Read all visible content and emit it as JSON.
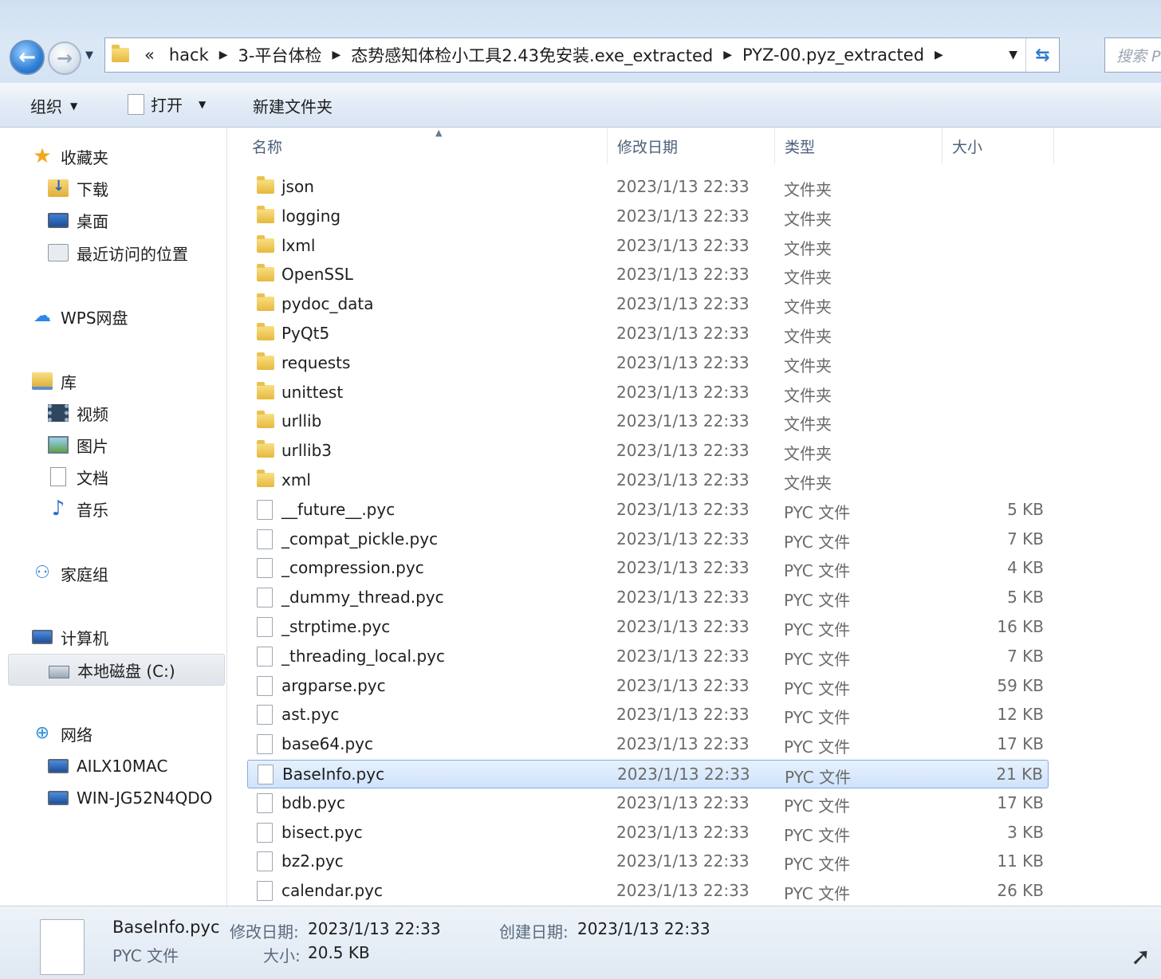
{
  "address": {
    "overflow_label": "«",
    "crumbs": [
      "hack",
      "3-平台体检",
      "态势感知体检小工具2.43免安装.exe_extracted",
      "PYZ-00.pyz_extracted"
    ],
    "search_placeholder": "搜索 P"
  },
  "toolbar": {
    "organize": "组织",
    "open": "打开",
    "new_folder": "新建文件夹"
  },
  "nav": {
    "favorites": "收藏夹",
    "downloads": "下载",
    "desktop": "桌面",
    "recent": "最近访问的位置",
    "wps": "WPS网盘",
    "libraries": "库",
    "videos": "视频",
    "pictures": "图片",
    "documents": "文档",
    "music": "音乐",
    "homegroup": "家庭组",
    "computer": "计算机",
    "local_disk": "本地磁盘 (C:)",
    "network": "网络",
    "net_pc1": "AILX10MAC",
    "net_pc2": "WIN-JG52N4QDO"
  },
  "columns": {
    "name": "名称",
    "modified": "修改日期",
    "type": "类型",
    "size": "大小"
  },
  "files": [
    {
      "name": "json",
      "date": "2023/1/13 22:33",
      "type": "文件夹",
      "size": "",
      "kind": "folder"
    },
    {
      "name": "logging",
      "date": "2023/1/13 22:33",
      "type": "文件夹",
      "size": "",
      "kind": "folder"
    },
    {
      "name": "lxml",
      "date": "2023/1/13 22:33",
      "type": "文件夹",
      "size": "",
      "kind": "folder"
    },
    {
      "name": "OpenSSL",
      "date": "2023/1/13 22:33",
      "type": "文件夹",
      "size": "",
      "kind": "folder"
    },
    {
      "name": "pydoc_data",
      "date": "2023/1/13 22:33",
      "type": "文件夹",
      "size": "",
      "kind": "folder"
    },
    {
      "name": "PyQt5",
      "date": "2023/1/13 22:33",
      "type": "文件夹",
      "size": "",
      "kind": "folder"
    },
    {
      "name": "requests",
      "date": "2023/1/13 22:33",
      "type": "文件夹",
      "size": "",
      "kind": "folder"
    },
    {
      "name": "unittest",
      "date": "2023/1/13 22:33",
      "type": "文件夹",
      "size": "",
      "kind": "folder"
    },
    {
      "name": "urllib",
      "date": "2023/1/13 22:33",
      "type": "文件夹",
      "size": "",
      "kind": "folder"
    },
    {
      "name": "urllib3",
      "date": "2023/1/13 22:33",
      "type": "文件夹",
      "size": "",
      "kind": "folder"
    },
    {
      "name": "xml",
      "date": "2023/1/13 22:33",
      "type": "文件夹",
      "size": "",
      "kind": "folder"
    },
    {
      "name": "__future__.pyc",
      "date": "2023/1/13 22:33",
      "type": "PYC 文件",
      "size": "5 KB",
      "kind": "file"
    },
    {
      "name": "_compat_pickle.pyc",
      "date": "2023/1/13 22:33",
      "type": "PYC 文件",
      "size": "7 KB",
      "kind": "file"
    },
    {
      "name": "_compression.pyc",
      "date": "2023/1/13 22:33",
      "type": "PYC 文件",
      "size": "4 KB",
      "kind": "file"
    },
    {
      "name": "_dummy_thread.pyc",
      "date": "2023/1/13 22:33",
      "type": "PYC 文件",
      "size": "5 KB",
      "kind": "file"
    },
    {
      "name": "_strptime.pyc",
      "date": "2023/1/13 22:33",
      "type": "PYC 文件",
      "size": "16 KB",
      "kind": "file"
    },
    {
      "name": "_threading_local.pyc",
      "date": "2023/1/13 22:33",
      "type": "PYC 文件",
      "size": "7 KB",
      "kind": "file"
    },
    {
      "name": "argparse.pyc",
      "date": "2023/1/13 22:33",
      "type": "PYC 文件",
      "size": "59 KB",
      "kind": "file"
    },
    {
      "name": "ast.pyc",
      "date": "2023/1/13 22:33",
      "type": "PYC 文件",
      "size": "12 KB",
      "kind": "file"
    },
    {
      "name": "base64.pyc",
      "date": "2023/1/13 22:33",
      "type": "PYC 文件",
      "size": "17 KB",
      "kind": "file"
    },
    {
      "name": "BaseInfo.pyc",
      "date": "2023/1/13 22:33",
      "type": "PYC 文件",
      "size": "21 KB",
      "kind": "file",
      "selected": true
    },
    {
      "name": "bdb.pyc",
      "date": "2023/1/13 22:33",
      "type": "PYC 文件",
      "size": "17 KB",
      "kind": "file"
    },
    {
      "name": "bisect.pyc",
      "date": "2023/1/13 22:33",
      "type": "PYC 文件",
      "size": "3 KB",
      "kind": "file"
    },
    {
      "name": "bz2.pyc",
      "date": "2023/1/13 22:33",
      "type": "PYC 文件",
      "size": "11 KB",
      "kind": "file"
    },
    {
      "name": "calendar.pyc",
      "date": "2023/1/13 22:33",
      "type": "PYC 文件",
      "size": "26 KB",
      "kind": "file"
    }
  ],
  "details": {
    "filename": "BaseInfo.pyc",
    "filetype": "PYC 文件",
    "modified_label": "修改日期:",
    "modified_value": "2023/1/13 22:33",
    "created_label": "创建日期:",
    "created_value": "2023/1/13 22:33",
    "size_label": "大小:",
    "size_value": "20.5 KB"
  },
  "colors": {
    "selection": "#cfe3fb",
    "selection_border": "#84acdd",
    "chrome": "#dbe8f6"
  }
}
